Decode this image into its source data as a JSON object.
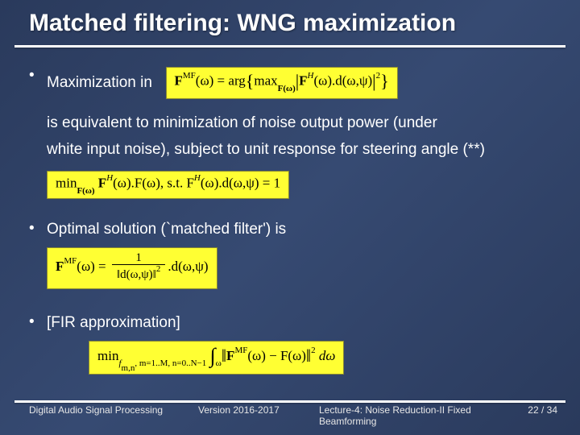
{
  "title": "Matched filtering: WNG maximization",
  "bullets": {
    "b1_lead": "Maximization in",
    "b1_cont1": "is equivalent to minimization of noise output power (under",
    "b1_cont2": "white input noise), subject to unit response for steering angle (**)",
    "b2": "Optimal solution (`matched filter') is",
    "b3": "[FIR approximation]"
  },
  "bullet_marker": "•",
  "formulas": {
    "f1_a": "F",
    "f1_sup1": "MF",
    "f1_b": "(ω) = arg",
    "f1_big1": "{",
    "f1_c": "max",
    "f1_sub1": "F(ω)",
    "f1_big2": "|",
    "f1_d": "F",
    "f1_sup2": "H",
    "f1_e": "(ω).d(ω,ψ)",
    "f1_big3": "|",
    "f1_sup3": "2",
    "f1_big4": "}",
    "f2_a": "min",
    "f2_sub1": "F(ω)",
    "f2_b": " F",
    "f2_sup1": "H",
    "f2_c": "(ω).F(ω),   s.t.   F",
    "f2_sup2": "H",
    "f2_d": "(ω).d(ω,ψ) = 1",
    "f3_a": "F",
    "f3_sup1": "MF",
    "f3_b": "(ω) = ",
    "f3_num": "1",
    "f3_den_a": "‖d(ω,ψ)‖",
    "f3_den_sup": "2",
    "f3_c": ".d(ω,ψ)",
    "f4_a": "min",
    "f4_sub1": "f",
    "f4_sub1b": "m,n",
    "f4_sub1c": ", m=1..M, n=0..N−1",
    "f4_big1": "∫",
    "f4_sub2": "ω",
    "f4_big2": "‖",
    "f4_b": "F",
    "f4_sup1": "MF",
    "f4_c": "(ω) − F(ω)",
    "f4_big3": "‖",
    "f4_sup2": "2",
    "f4_d": " dω"
  },
  "footer": {
    "left": "Digital Audio Signal Processing",
    "mid": "Version 2016-2017",
    "lecture": "Lecture-4: Noise Reduction-II Fixed Beamforming",
    "page": "22 / 34"
  }
}
